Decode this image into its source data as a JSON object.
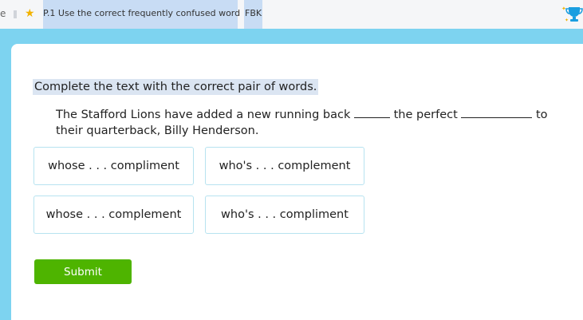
{
  "topbar": {
    "crumb_prefix": "e",
    "skill_title": "P.1 Use the correct frequently confused word",
    "fbk_label": "FBK",
    "colors": {
      "highlight": "#c8dcf4",
      "star": "#f2b200",
      "trophy": "#1a9ee0"
    }
  },
  "question": {
    "instruction": "Complete the text with the correct pair of words.",
    "passage_part1": "The Stafford Lions have added a new running back",
    "passage_part2": "the perfect",
    "passage_part3": "to their quarterback, Billy Henderson."
  },
  "choices": [
    {
      "label": "whose . . . compliment"
    },
    {
      "label": "who's . . . complement"
    },
    {
      "label": "whose . . . complement"
    },
    {
      "label": "who's . . . compliment"
    }
  ],
  "submit_label": "Submit",
  "colors": {
    "background": "#7dd3f0",
    "submit": "#4eb400",
    "choice_border": "#b7e3f0"
  }
}
